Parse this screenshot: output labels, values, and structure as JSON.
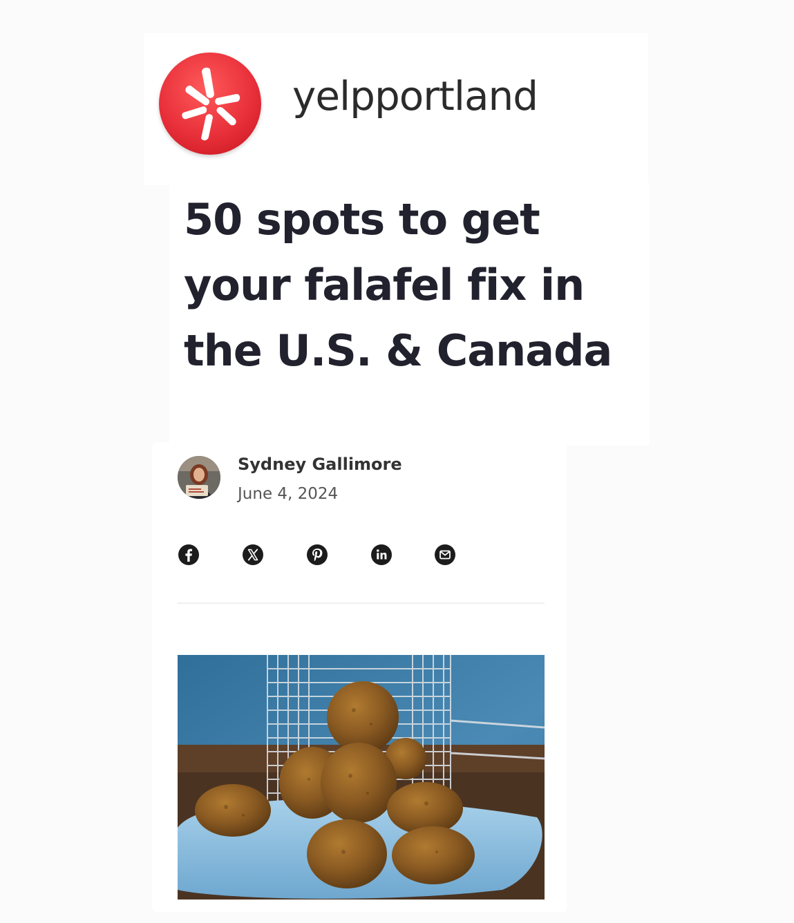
{
  "brand": {
    "name": "yelpportland",
    "logo_color": "#e8303a"
  },
  "article": {
    "title": "50 spots to get your falafel fix in the U.S. & Canada",
    "author": "Sydney Gallimore",
    "date": "June 4, 2024"
  },
  "share": [
    {
      "icon": "facebook-icon"
    },
    {
      "icon": "x-icon"
    },
    {
      "icon": "pinterest-icon"
    },
    {
      "icon": "linkedin-icon"
    },
    {
      "icon": "email-icon"
    }
  ],
  "colors": {
    "title": "#22222e",
    "text": "#333333",
    "icon": "#1c1c1c",
    "photo_background": "#3d7ca6",
    "plate": "#8ebfe0",
    "falafel": "#8a5a22"
  }
}
